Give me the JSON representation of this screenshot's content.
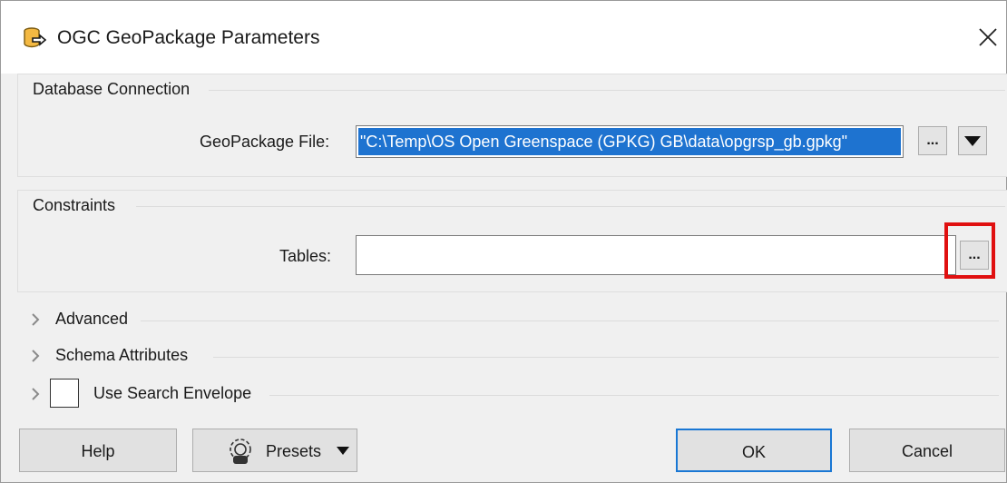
{
  "window": {
    "title": "OGC GeoPackage Parameters"
  },
  "database_connection": {
    "group_title": "Database Connection",
    "file_label": "GeoPackage File:",
    "file_value": "\"C:\\Temp\\OS Open Greenspace (GPKG) GB\\data\\opgrsp_gb.gpkg\"",
    "browse_label": "..."
  },
  "constraints": {
    "group_title": "Constraints",
    "tables_label": "Tables:",
    "tables_value": "",
    "browse_label": "..."
  },
  "sections": {
    "advanced": "Advanced",
    "schema_attributes": "Schema Attributes",
    "use_search_envelope": "Use Search Envelope"
  },
  "buttons": {
    "help": "Help",
    "presets": "Presets",
    "ok": "OK",
    "cancel": "Cancel"
  },
  "colors": {
    "selection": "#1e73d0",
    "highlight": "#e01010",
    "ok_border": "#1977d4"
  }
}
